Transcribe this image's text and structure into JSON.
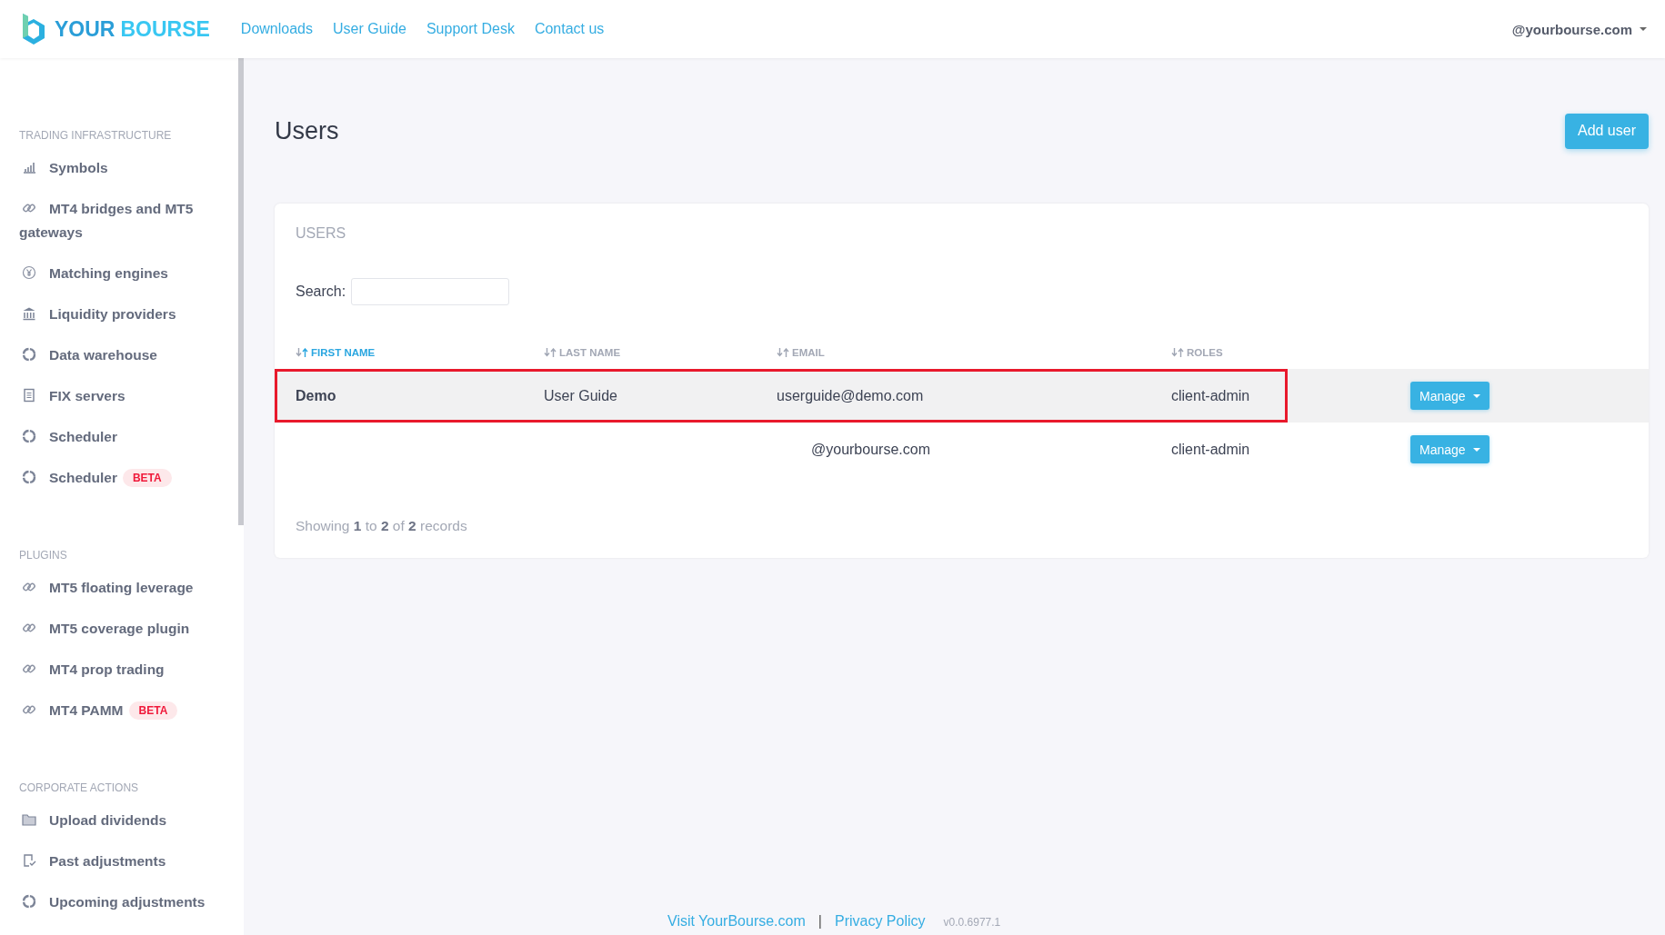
{
  "header": {
    "logo": {
      "word_1": "YOUR",
      "word_2": "BOURSE"
    },
    "nav": [
      "Downloads",
      "User Guide",
      "Support Desk",
      "Contact us"
    ],
    "account": "@yourbourse.com"
  },
  "sidebar": {
    "sections": [
      {
        "title": "TRADING INFRASTRUCTURE",
        "items": [
          {
            "label": "Symbols",
            "kind": "bars"
          },
          {
            "label": "MT4 bridges and MT5 gateways",
            "kind": "link"
          },
          {
            "label": "Matching engines",
            "kind": "yen"
          },
          {
            "label": "Liquidity providers",
            "kind": "bank"
          },
          {
            "label": "Data warehouse",
            "kind": "ring"
          },
          {
            "label": "FIX servers",
            "kind": "doc"
          },
          {
            "label": "Scheduler",
            "kind": "ring"
          },
          {
            "label": "Scheduler",
            "kind": "ring",
            "badge": "BETA"
          }
        ]
      },
      {
        "title": "PLUGINS",
        "items": [
          {
            "label": "MT5 floating leverage",
            "kind": "link"
          },
          {
            "label": "MT5 coverage plugin",
            "kind": "link"
          },
          {
            "label": "MT4 prop trading",
            "kind": "link"
          },
          {
            "label": "MT4 PAMM",
            "kind": "link",
            "badge": "BETA"
          }
        ]
      },
      {
        "title": "CORPORATE ACTIONS",
        "items": [
          {
            "label": "Upload dividends",
            "kind": "folder"
          },
          {
            "label": "Past adjustments",
            "kind": "check-doc"
          },
          {
            "label": "Upcoming adjustments",
            "kind": "ring"
          }
        ]
      }
    ]
  },
  "page": {
    "title": "Users",
    "add_button": "Add user"
  },
  "card": {
    "title": "USERS",
    "search": {
      "label": "Search:"
    },
    "table": {
      "columns": [
        {
          "label": "FIRST NAME",
          "selected": true
        },
        {
          "label": "LAST NAME",
          "selected": false
        },
        {
          "label": "EMAIL",
          "selected": false
        },
        {
          "label": "ROLES",
          "selected": false
        }
      ],
      "rows": [
        {
          "first_name": "Demo",
          "last_name": "User Guide",
          "email": "userguide@demo.com",
          "roles": "client-admin",
          "action": "Manage",
          "selected": true,
          "outlined": true
        },
        {
          "email": "@yourbourse.com",
          "roles": "client-admin",
          "action": "Manage",
          "selected": false,
          "outlined": false
        }
      ]
    },
    "summary": "Showing **1** to **2** of **2** records"
  },
  "footer": {
    "links": [
      "Visit YourBourse.com",
      "Privacy Policy"
    ],
    "separator": "|",
    "version": "v0.0.6977.1"
  }
}
